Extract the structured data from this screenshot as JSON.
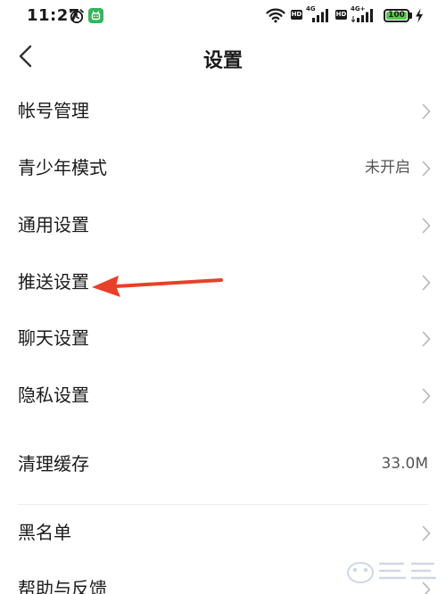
{
  "status_bar": {
    "time": "11:27",
    "sim1": {
      "hd": "HD",
      "network": "4G"
    },
    "sim2": {
      "hd": "HD",
      "network": "4G+"
    },
    "battery": {
      "text": "100",
      "level_percent": 100
    },
    "icons": [
      "alarm-icon",
      "app-notify-icon",
      "wifi-icon",
      "signal-icon",
      "battery-icon",
      "charging-icon"
    ]
  },
  "header": {
    "title": "设置",
    "back_icon": "chevron-left-icon"
  },
  "settings": {
    "items": [
      {
        "label": "帐号管理",
        "value": "",
        "chevron": true
      },
      {
        "label": "青少年模式",
        "value": "未开启",
        "chevron": true
      },
      {
        "label": "通用设置",
        "value": "",
        "chevron": true
      },
      {
        "label": "推送设置",
        "value": "",
        "chevron": true
      },
      {
        "label": "聊天设置",
        "value": "",
        "chevron": true
      },
      {
        "label": "隐私设置",
        "value": "",
        "chevron": true
      },
      {
        "label": "清理缓存",
        "value": "33.0M",
        "chevron": false
      },
      {
        "label": "黑名单",
        "value": "",
        "chevron": true
      },
      {
        "label": "帮助与反馈",
        "value": "",
        "chevron": true
      }
    ]
  },
  "annotation": {
    "type": "arrow",
    "color": "#e8402a",
    "points_to": "推送设置"
  },
  "colors": {
    "accent_green": "#35b55a",
    "battery_green": "#56c84a",
    "annotation_red": "#e8402a"
  }
}
